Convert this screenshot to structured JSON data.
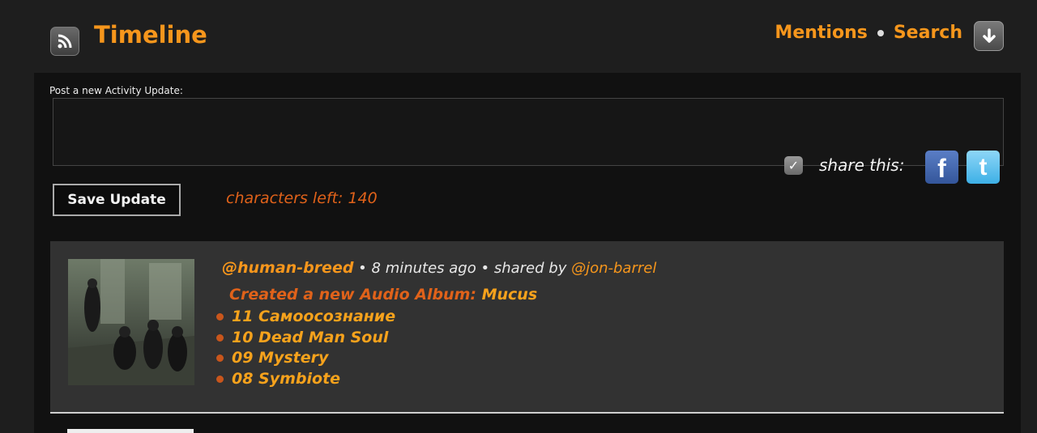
{
  "header": {
    "title": "Timeline",
    "nav": {
      "mentions": "Mentions",
      "search": "Search"
    }
  },
  "post": {
    "label": "Post a new Activity Update:",
    "textarea_value": "",
    "share_label": "share this:",
    "share_checked": true,
    "facebook_glyph": "f",
    "twitter_glyph": "t",
    "save_label": "Save Update",
    "chars_left": "characters left: 140"
  },
  "activity": {
    "user": "@human-breed",
    "time": "8 minutes ago",
    "shared_by_prefix": "shared by",
    "shared_by_user": "@jon-barrel",
    "action_text": "Created a new Audio Album:",
    "album": "Mucus",
    "tracks": [
      {
        "label": "11 Самоосознание"
      },
      {
        "label": "10 Dead Man Soul"
      },
      {
        "label": "09 Mystery"
      },
      {
        "label": "08 Symbiote"
      }
    ]
  },
  "icons": {
    "rss": "rss-icon",
    "download": "arrow-down-icon",
    "check": "checkmark-icon",
    "facebook": "facebook-icon",
    "twitter": "twitter-icon"
  },
  "colors": {
    "accent": "#f6961c",
    "accent_dark": "#e0621a",
    "background": "#1e1e1e",
    "panel": "#111111",
    "card": "#323232"
  }
}
